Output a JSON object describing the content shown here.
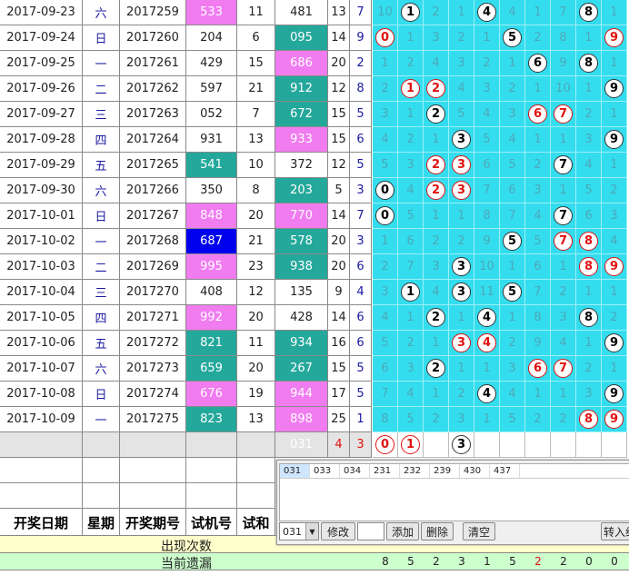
{
  "rows": [
    {
      "date": "2017-09-23",
      "week": "六",
      "issue": "2017259",
      "trial": "533",
      "trial_color": "pink",
      "sum": "11",
      "open": "481",
      "open_color": "white",
      "a1": "13",
      "a2": "7",
      "digits": [
        {
          "v": "10",
          "ball": ""
        },
        {
          "v": "1",
          "ball": "black"
        },
        {
          "v": "2",
          "ball": ""
        },
        {
          "v": "1",
          "ball": ""
        },
        {
          "v": "4",
          "ball": "black"
        },
        {
          "v": "4",
          "ball": ""
        },
        {
          "v": "1",
          "ball": ""
        },
        {
          "v": "7",
          "ball": ""
        },
        {
          "v": "8",
          "ball": "black"
        },
        {
          "v": "1",
          "ball": ""
        }
      ]
    },
    {
      "date": "2017-09-24",
      "week": "日",
      "issue": "2017260",
      "trial": "204",
      "trial_color": "white",
      "sum": "6",
      "open": "095",
      "open_color": "teal",
      "a1": "14",
      "a2": "9",
      "digits": [
        {
          "v": "0",
          "ball": "red"
        },
        {
          "v": "1",
          "ball": ""
        },
        {
          "v": "3",
          "ball": ""
        },
        {
          "v": "2",
          "ball": ""
        },
        {
          "v": "1",
          "ball": ""
        },
        {
          "v": "5",
          "ball": "black"
        },
        {
          "v": "2",
          "ball": ""
        },
        {
          "v": "8",
          "ball": ""
        },
        {
          "v": "1",
          "ball": ""
        },
        {
          "v": "9",
          "ball": "red"
        }
      ]
    },
    {
      "date": "2017-09-25",
      "week": "一",
      "issue": "2017261",
      "trial": "429",
      "trial_color": "white",
      "sum": "15",
      "open": "686",
      "open_color": "pink",
      "a1": "20",
      "a2": "2",
      "digits": [
        {
          "v": "1",
          "ball": ""
        },
        {
          "v": "2",
          "ball": ""
        },
        {
          "v": "4",
          "ball": ""
        },
        {
          "v": "3",
          "ball": ""
        },
        {
          "v": "2",
          "ball": ""
        },
        {
          "v": "1",
          "ball": ""
        },
        {
          "v": "6",
          "ball": "black"
        },
        {
          "v": "9",
          "ball": ""
        },
        {
          "v": "8",
          "ball": "black"
        },
        {
          "v": "1",
          "ball": ""
        }
      ]
    },
    {
      "date": "2017-09-26",
      "week": "二",
      "issue": "2017262",
      "trial": "597",
      "trial_color": "white",
      "sum": "21",
      "open": "912",
      "open_color": "teal",
      "a1": "12",
      "a2": "8",
      "digits": [
        {
          "v": "2",
          "ball": ""
        },
        {
          "v": "1",
          "ball": "red"
        },
        {
          "v": "2",
          "ball": "red"
        },
        {
          "v": "4",
          "ball": ""
        },
        {
          "v": "3",
          "ball": ""
        },
        {
          "v": "2",
          "ball": ""
        },
        {
          "v": "1",
          "ball": ""
        },
        {
          "v": "10",
          "ball": ""
        },
        {
          "v": "1",
          "ball": ""
        },
        {
          "v": "9",
          "ball": "black"
        }
      ]
    },
    {
      "date": "2017-09-27",
      "week": "三",
      "issue": "2017263",
      "trial": "052",
      "trial_color": "white",
      "sum": "7",
      "open": "672",
      "open_color": "teal",
      "a1": "15",
      "a2": "5",
      "digits": [
        {
          "v": "3",
          "ball": ""
        },
        {
          "v": "1",
          "ball": ""
        },
        {
          "v": "2",
          "ball": "black"
        },
        {
          "v": "5",
          "ball": ""
        },
        {
          "v": "4",
          "ball": ""
        },
        {
          "v": "3",
          "ball": ""
        },
        {
          "v": "6",
          "ball": "red"
        },
        {
          "v": "7",
          "ball": "red"
        },
        {
          "v": "2",
          "ball": ""
        },
        {
          "v": "1",
          "ball": ""
        }
      ]
    },
    {
      "date": "2017-09-28",
      "week": "四",
      "issue": "2017264",
      "trial": "931",
      "trial_color": "white",
      "sum": "13",
      "open": "933",
      "open_color": "pink",
      "a1": "15",
      "a2": "6",
      "digits": [
        {
          "v": "4",
          "ball": ""
        },
        {
          "v": "2",
          "ball": ""
        },
        {
          "v": "1",
          "ball": ""
        },
        {
          "v": "3",
          "ball": "black"
        },
        {
          "v": "5",
          "ball": ""
        },
        {
          "v": "4",
          "ball": ""
        },
        {
          "v": "1",
          "ball": ""
        },
        {
          "v": "1",
          "ball": ""
        },
        {
          "v": "3",
          "ball": ""
        },
        {
          "v": "9",
          "ball": "black"
        }
      ]
    },
    {
      "date": "2017-09-29",
      "week": "五",
      "issue": "2017265",
      "trial": "541",
      "trial_color": "teal",
      "sum": "10",
      "open": "372",
      "open_color": "white",
      "a1": "12",
      "a2": "5",
      "digits": [
        {
          "v": "5",
          "ball": ""
        },
        {
          "v": "3",
          "ball": ""
        },
        {
          "v": "2",
          "ball": "red"
        },
        {
          "v": "3",
          "ball": "red"
        },
        {
          "v": "6",
          "ball": ""
        },
        {
          "v": "5",
          "ball": ""
        },
        {
          "v": "2",
          "ball": ""
        },
        {
          "v": "7",
          "ball": "black"
        },
        {
          "v": "4",
          "ball": ""
        },
        {
          "v": "1",
          "ball": ""
        }
      ]
    },
    {
      "date": "2017-09-30",
      "week": "六",
      "issue": "2017266",
      "trial": "350",
      "trial_color": "white",
      "sum": "8",
      "open": "203",
      "open_color": "teal",
      "a1": "5",
      "a2": "3",
      "digits": [
        {
          "v": "0",
          "ball": "black"
        },
        {
          "v": "4",
          "ball": ""
        },
        {
          "v": "2",
          "ball": "red"
        },
        {
          "v": "3",
          "ball": "red"
        },
        {
          "v": "7",
          "ball": ""
        },
        {
          "v": "6",
          "ball": ""
        },
        {
          "v": "3",
          "ball": ""
        },
        {
          "v": "1",
          "ball": ""
        },
        {
          "v": "5",
          "ball": ""
        },
        {
          "v": "2",
          "ball": ""
        }
      ]
    },
    {
      "date": "2017-10-01",
      "week": "日",
      "issue": "2017267",
      "trial": "848",
      "trial_color": "pink",
      "sum": "20",
      "open": "770",
      "open_color": "pink",
      "a1": "14",
      "a2": "7",
      "digits": [
        {
          "v": "0",
          "ball": "black"
        },
        {
          "v": "5",
          "ball": ""
        },
        {
          "v": "1",
          "ball": ""
        },
        {
          "v": "1",
          "ball": ""
        },
        {
          "v": "8",
          "ball": ""
        },
        {
          "v": "7",
          "ball": ""
        },
        {
          "v": "4",
          "ball": ""
        },
        {
          "v": "7",
          "ball": "black"
        },
        {
          "v": "6",
          "ball": ""
        },
        {
          "v": "3",
          "ball": ""
        }
      ]
    },
    {
      "date": "2017-10-02",
      "week": "一",
      "issue": "2017268",
      "trial": "687",
      "trial_color": "blue",
      "sum": "21",
      "open": "578",
      "open_color": "teal",
      "a1": "20",
      "a2": "3",
      "digits": [
        {
          "v": "1",
          "ball": ""
        },
        {
          "v": "6",
          "ball": ""
        },
        {
          "v": "2",
          "ball": ""
        },
        {
          "v": "2",
          "ball": ""
        },
        {
          "v": "9",
          "ball": ""
        },
        {
          "v": "5",
          "ball": "black"
        },
        {
          "v": "5",
          "ball": ""
        },
        {
          "v": "7",
          "ball": "red"
        },
        {
          "v": "8",
          "ball": "red"
        },
        {
          "v": "4",
          "ball": ""
        }
      ]
    },
    {
      "date": "2017-10-03",
      "week": "二",
      "issue": "2017269",
      "trial": "995",
      "trial_color": "pink",
      "sum": "23",
      "open": "938",
      "open_color": "teal",
      "a1": "20",
      "a2": "6",
      "digits": [
        {
          "v": "2",
          "ball": ""
        },
        {
          "v": "7",
          "ball": ""
        },
        {
          "v": "3",
          "ball": ""
        },
        {
          "v": "3",
          "ball": "black"
        },
        {
          "v": "10",
          "ball": ""
        },
        {
          "v": "1",
          "ball": ""
        },
        {
          "v": "6",
          "ball": ""
        },
        {
          "v": "1",
          "ball": ""
        },
        {
          "v": "8",
          "ball": "red"
        },
        {
          "v": "9",
          "ball": "red"
        }
      ]
    },
    {
      "date": "2017-10-04",
      "week": "三",
      "issue": "2017270",
      "trial": "408",
      "trial_color": "white",
      "sum": "12",
      "open": "135",
      "open_color": "white",
      "a1": "9",
      "a2": "4",
      "digits": [
        {
          "v": "3",
          "ball": ""
        },
        {
          "v": "1",
          "ball": "black"
        },
        {
          "v": "4",
          "ball": ""
        },
        {
          "v": "3",
          "ball": "black"
        },
        {
          "v": "11",
          "ball": ""
        },
        {
          "v": "5",
          "ball": "black"
        },
        {
          "v": "7",
          "ball": ""
        },
        {
          "v": "2",
          "ball": ""
        },
        {
          "v": "1",
          "ball": ""
        },
        {
          "v": "1",
          "ball": ""
        }
      ]
    },
    {
      "date": "2017-10-05",
      "week": "四",
      "issue": "2017271",
      "trial": "992",
      "trial_color": "pink",
      "sum": "20",
      "open": "428",
      "open_color": "white",
      "a1": "14",
      "a2": "6",
      "digits": [
        {
          "v": "4",
          "ball": ""
        },
        {
          "v": "1",
          "ball": ""
        },
        {
          "v": "2",
          "ball": "black"
        },
        {
          "v": "1",
          "ball": ""
        },
        {
          "v": "4",
          "ball": "black"
        },
        {
          "v": "1",
          "ball": ""
        },
        {
          "v": "8",
          "ball": ""
        },
        {
          "v": "3",
          "ball": ""
        },
        {
          "v": "8",
          "ball": "black"
        },
        {
          "v": "2",
          "ball": ""
        }
      ]
    },
    {
      "date": "2017-10-06",
      "week": "五",
      "issue": "2017272",
      "trial": "821",
      "trial_color": "teal",
      "sum": "11",
      "open": "934",
      "open_color": "teal",
      "a1": "16",
      "a2": "6",
      "digits": [
        {
          "v": "5",
          "ball": ""
        },
        {
          "v": "2",
          "ball": ""
        },
        {
          "v": "1",
          "ball": ""
        },
        {
          "v": "3",
          "ball": "red"
        },
        {
          "v": "4",
          "ball": "red"
        },
        {
          "v": "2",
          "ball": ""
        },
        {
          "v": "9",
          "ball": ""
        },
        {
          "v": "4",
          "ball": ""
        },
        {
          "v": "1",
          "ball": ""
        },
        {
          "v": "9",
          "ball": "black"
        }
      ]
    },
    {
      "date": "2017-10-07",
      "week": "六",
      "issue": "2017273",
      "trial": "659",
      "trial_color": "teal",
      "sum": "20",
      "open": "267",
      "open_color": "teal",
      "a1": "15",
      "a2": "5",
      "digits": [
        {
          "v": "6",
          "ball": ""
        },
        {
          "v": "3",
          "ball": ""
        },
        {
          "v": "2",
          "ball": "black"
        },
        {
          "v": "1",
          "ball": ""
        },
        {
          "v": "1",
          "ball": ""
        },
        {
          "v": "3",
          "ball": ""
        },
        {
          "v": "6",
          "ball": "red"
        },
        {
          "v": "7",
          "ball": "red"
        },
        {
          "v": "2",
          "ball": ""
        },
        {
          "v": "1",
          "ball": ""
        }
      ]
    },
    {
      "date": "2017-10-08",
      "week": "日",
      "issue": "2017274",
      "trial": "676",
      "trial_color": "pink",
      "sum": "19",
      "open": "944",
      "open_color": "pink",
      "a1": "17",
      "a2": "5",
      "digits": [
        {
          "v": "7",
          "ball": ""
        },
        {
          "v": "4",
          "ball": ""
        },
        {
          "v": "1",
          "ball": ""
        },
        {
          "v": "2",
          "ball": ""
        },
        {
          "v": "4",
          "ball": "black"
        },
        {
          "v": "4",
          "ball": ""
        },
        {
          "v": "1",
          "ball": ""
        },
        {
          "v": "1",
          "ball": ""
        },
        {
          "v": "3",
          "ball": ""
        },
        {
          "v": "9",
          "ball": "black"
        }
      ]
    },
    {
      "date": "2017-10-09",
      "week": "一",
      "issue": "2017275",
      "trial": "823",
      "trial_color": "teal",
      "sum": "13",
      "open": "898",
      "open_color": "pink",
      "a1": "25",
      "a2": "1",
      "digits": [
        {
          "v": "8",
          "ball": ""
        },
        {
          "v": "5",
          "ball": ""
        },
        {
          "v": "2",
          "ball": ""
        },
        {
          "v": "3",
          "ball": ""
        },
        {
          "v": "1",
          "ball": ""
        },
        {
          "v": "5",
          "ball": ""
        },
        {
          "v": "2",
          "ball": ""
        },
        {
          "v": "2",
          "ball": ""
        },
        {
          "v": "8",
          "ball": "red"
        },
        {
          "v": "9",
          "ball": "red"
        }
      ]
    }
  ],
  "summary_row": {
    "open": "031",
    "a1": "4",
    "a2": "3",
    "balls": [
      {
        "v": "0",
        "ball": "red"
      },
      {
        "v": "1",
        "ball": "red"
      },
      {
        "v": "",
        "ball": ""
      },
      {
        "v": "3",
        "ball": "black"
      }
    ]
  },
  "headers": {
    "date": "开奖日期",
    "week": "星期",
    "issue": "开奖期号",
    "trial": "试机号",
    "sum": "试和"
  },
  "footer": {
    "occurrences_label": "出现次数",
    "omission_label": "当前遗漏",
    "omission_values": [
      "8",
      "5",
      "2",
      "3",
      "1",
      "5",
      "2",
      "2",
      "0",
      "0"
    ],
    "omission_highlight_index": 6
  },
  "popup": {
    "tabs": [
      "031",
      "033",
      "034",
      "231",
      "232",
      "239",
      "430",
      "437"
    ],
    "combo_value": "031",
    "input_value": "",
    "buttons": {
      "edit": "修改",
      "add": "添加",
      "delete": "删除",
      "clear": "清空",
      "import": "转入组"
    }
  },
  "colors": {
    "pink": "#f07cf0",
    "teal": "#24a89b",
    "blue": "#0000ee",
    "cyan": "#33ddee",
    "red": "#e01010"
  }
}
